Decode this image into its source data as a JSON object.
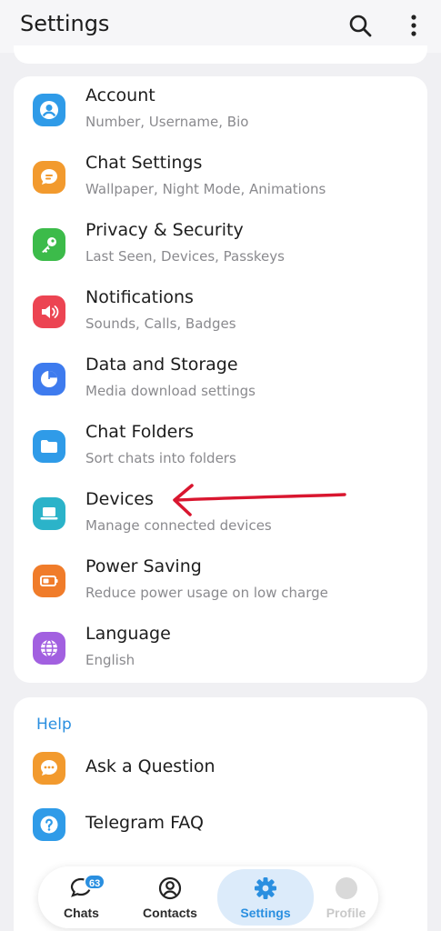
{
  "header": {
    "title": "Settings",
    "search_icon": "search-icon",
    "more_icon": "more-vertical-icon"
  },
  "settings": [
    {
      "label": "Account",
      "sub": "Number, Username, Bio",
      "icon": "person-icon",
      "color": "#2f9be8"
    },
    {
      "label": "Chat Settings",
      "sub": "Wallpaper, Night Mode, Animations",
      "icon": "chat-bubble-icon",
      "color": "#f29a2e"
    },
    {
      "label": "Privacy & Security",
      "sub": "Last Seen, Devices, Passkeys",
      "icon": "key-icon",
      "color": "#3cbb4a"
    },
    {
      "label": "Notifications",
      "sub": "Sounds, Calls, Badges",
      "icon": "speaker-icon",
      "color": "#ec4452"
    },
    {
      "label": "Data and Storage",
      "sub": "Media download settings",
      "icon": "pie-chart-icon",
      "color": "#3e7bee"
    },
    {
      "label": "Chat Folders",
      "sub": "Sort chats into folders",
      "icon": "folder-icon",
      "color": "#2f9be8"
    },
    {
      "label": "Devices",
      "sub": "Manage connected devices",
      "icon": "laptop-icon",
      "color": "#2bb3c9"
    },
    {
      "label": "Power Saving",
      "sub": "Reduce power usage on low charge",
      "icon": "battery-icon",
      "color": "#f07c2a"
    },
    {
      "label": "Language",
      "sub": "English",
      "icon": "globe-icon",
      "color": "#a260e0"
    }
  ],
  "help": {
    "title": "Help",
    "items": [
      {
        "label": "Ask a Question",
        "icon": "question-chat-icon",
        "color": "#f29a2e"
      },
      {
        "label": "Telegram FAQ",
        "icon": "question-icon",
        "color": "#2f9be8"
      }
    ]
  },
  "nav": {
    "chats": {
      "label": "Chats",
      "badge": "63"
    },
    "contacts": {
      "label": "Contacts"
    },
    "settings": {
      "label": "Settings"
    },
    "profile": {
      "label": "Profile"
    }
  },
  "colors": {
    "accent": "#2a8fe0",
    "annotation_arrow": "#d9162f"
  }
}
